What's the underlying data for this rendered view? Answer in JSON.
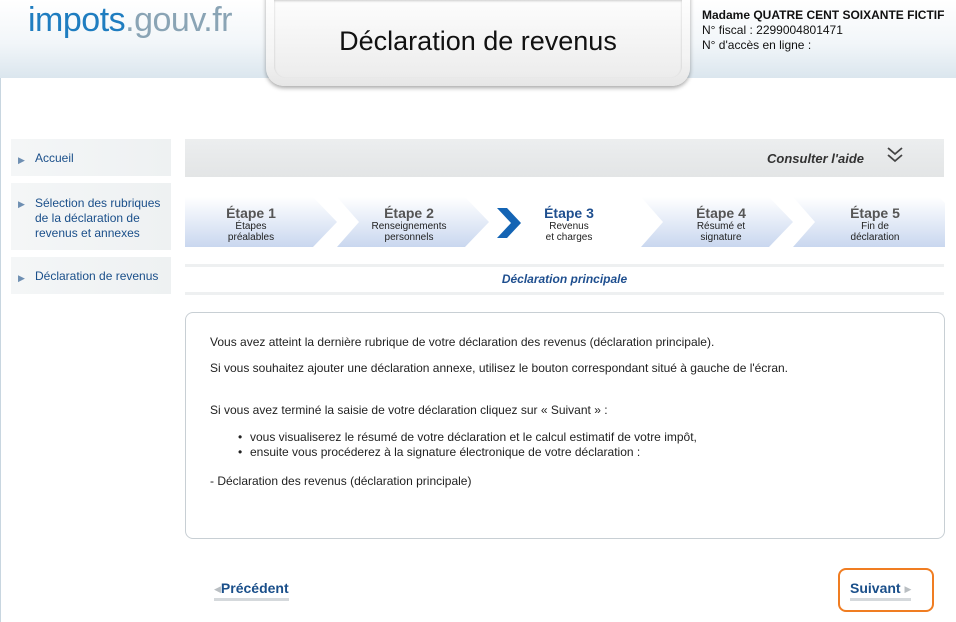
{
  "header": {
    "logo_part1": "impots",
    "logo_part2": ".gouv.fr",
    "title": "Déclaration de revenus",
    "user_name": "Madame QUATRE CENT SOIXANTE FICTIF",
    "fiscal_number": "N° fiscal : 2299004801471",
    "access_number": "N° d'accès en ligne :"
  },
  "sidebar": {
    "items": [
      {
        "label": "Accueil"
      },
      {
        "label": "Sélection des rubriques de la déclaration de revenus et annexes"
      },
      {
        "label": "Déclaration de revenus"
      }
    ]
  },
  "help": {
    "label": "Consulter l'aide",
    "icon": "double-chevron-down-icon"
  },
  "steps": [
    {
      "label": "Étape 1",
      "desc1": "Étapes",
      "desc2": "préalables",
      "state": "done"
    },
    {
      "label": "Étape 2",
      "desc1": "Renseignements",
      "desc2": "personnels",
      "state": "done"
    },
    {
      "label": "Étape 3",
      "desc1": "Revenus",
      "desc2": "et charges",
      "state": "active"
    },
    {
      "label": "Étape 4",
      "desc1": "Résumé et",
      "desc2": "signature",
      "state": "todo"
    },
    {
      "label": "Étape 5",
      "desc1": "Fin de",
      "desc2": "déclaration",
      "state": "todo"
    }
  ],
  "section_title": "Déclaration principale",
  "content": {
    "p1": "Vous avez atteint la dernière rubrique de votre déclaration des revenus (déclaration principale).",
    "p2": "Si vous souhaitez ajouter une déclaration annexe, utilisez le bouton correspondant situé à gauche de l'écran.",
    "p3": "Si vous avez terminé la saisie de votre déclaration cliquez sur « Suivant » :",
    "bullets": [
      "vous visualiserez le résumé de votre déclaration et le calcul estimatif de votre impôt,",
      "ensuite vous procéderez à la signature électronique de votre déclaration :"
    ],
    "sub_item": "- Déclaration des revenus (déclaration principale)"
  },
  "nav": {
    "previous": "Précédent",
    "next": "Suivant"
  },
  "colors": {
    "accent_blue": "#1f4f8f",
    "logo_blue": "#1f7dc0",
    "highlight_orange": "#f07d22"
  }
}
